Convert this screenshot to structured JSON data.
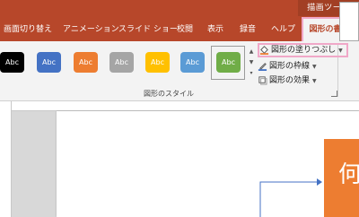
{
  "context_tab": "描画ツール",
  "tabs": [
    {
      "label": "画面切り替え"
    },
    {
      "label": "アニメーション"
    },
    {
      "label": "スライド ショー"
    },
    {
      "label": "校閲"
    },
    {
      "label": "表示"
    },
    {
      "label": "録音"
    },
    {
      "label": "ヘルプ"
    },
    {
      "label": "図形の書式"
    }
  ],
  "shape_styles": {
    "group_label": "図形のスタイル",
    "swatches": [
      {
        "label": "Abc",
        "color": "#000000"
      },
      {
        "label": "Abc",
        "color": "#4472c4"
      },
      {
        "label": "Abc",
        "color": "#ed7d31"
      },
      {
        "label": "Abc",
        "color": "#a5a5a5"
      },
      {
        "label": "Abc",
        "color": "#ffc000"
      },
      {
        "label": "Abc",
        "color": "#5b9bd5"
      },
      {
        "label": "Abc",
        "color": "#70ad47"
      }
    ]
  },
  "shape_commands": {
    "fill": "図形の塗りつぶし",
    "outline": "図形の枠線",
    "effects": "図形の効果"
  },
  "slide": {
    "shape_text": "何"
  },
  "colors": {
    "ribbon_accent": "#b7472a",
    "highlight": "#f0a8c8"
  }
}
